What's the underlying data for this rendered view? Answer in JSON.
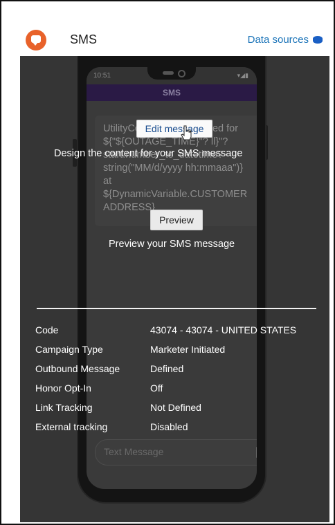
{
  "header": {
    "title": "SMS",
    "data_sources_label": "Data sources",
    "icon": "chat-bubble-icon",
    "data_sources_icon": "database-icon",
    "accent_color": "#e8622a",
    "link_color": "#1a73b8"
  },
  "phone": {
    "time": "10:51",
    "status_icons": "▾◢▮",
    "app_title": "SMS",
    "message_lines": [
      "UtilityCo",
      "${\"${OUTAGE_TIME}\"?",
      "start.number_to_datetime?",
      "string(\"MM/d/yyyy hh:mmaaa\")}",
      "at",
      "${DynamicVariable.CUSTOMER",
      "ADDRESS}"
    ],
    "message_tail": "ed for",
    "message_tail2": "ll}\"?",
    "compose_placeholder": "Text Message"
  },
  "overlay": {
    "edit_button": "Edit message",
    "edit_caption": "Design the content for your SMS message",
    "preview_button": "Preview",
    "preview_caption": "Preview your SMS message"
  },
  "details": [
    {
      "label": "Code",
      "value": "43074 - 43074 - UNITED STATES"
    },
    {
      "label": "Campaign Type",
      "value": "Marketer Initiated"
    },
    {
      "label": "Outbound Message",
      "value": "Defined"
    },
    {
      "label": "Honor Opt-In",
      "value": "Off"
    },
    {
      "label": "Link Tracking",
      "value": "Not Defined"
    },
    {
      "label": "External tracking",
      "value": "Disabled"
    }
  ]
}
